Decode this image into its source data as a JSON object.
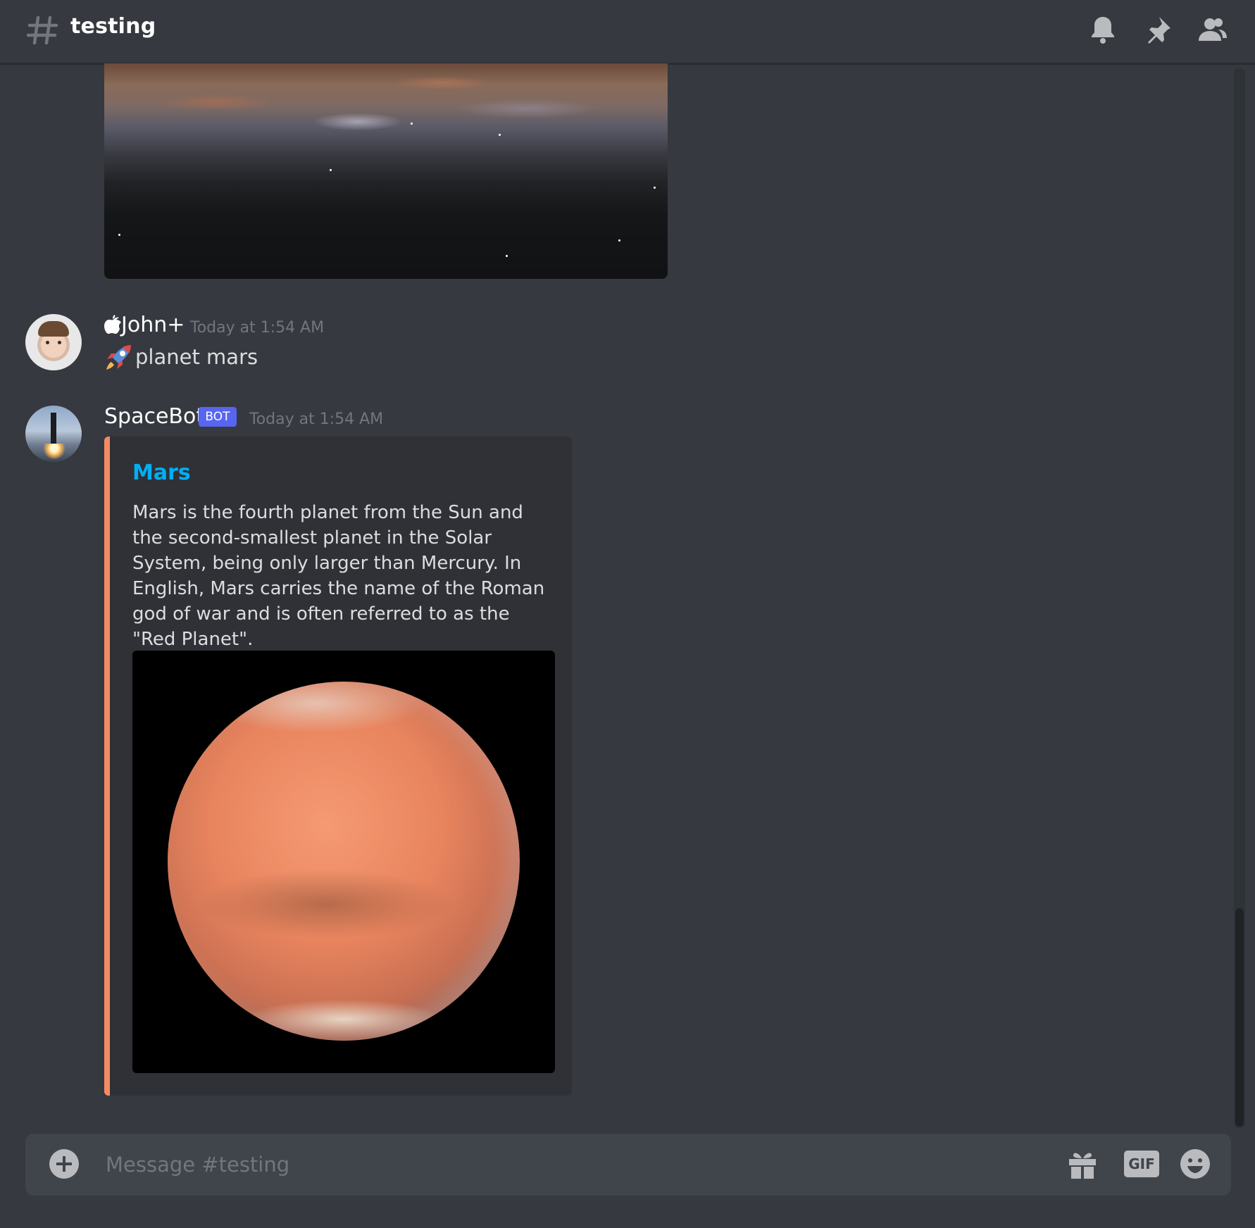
{
  "header": {
    "channel_name": "testing"
  },
  "messages": [
    {
      "author": "John+",
      "timestamp": "Today at 1:54 AM",
      "text": "planet mars"
    },
    {
      "author": "SpaceBot",
      "bot_tag": "BOT",
      "timestamp": "Today at 1:54 AM",
      "embed": {
        "title": "Mars",
        "description": "Mars is the fourth planet from the Sun and the second-smallest planet in the Solar System, being only larger than Mercury. In English, Mars carries the name of the Roman god of war and is often referred to as the \"Red Planet\".",
        "accent_color": "#f58b63",
        "title_color": "#00aff4"
      }
    }
  ],
  "composer": {
    "placeholder": "Message #testing",
    "gif_label": "GIF"
  },
  "colors": {
    "background": "#36393f",
    "embed_background": "#2f3136",
    "composer_background": "#40444b",
    "bot_tag": "#5865f2",
    "muted_text": "#72767d"
  }
}
